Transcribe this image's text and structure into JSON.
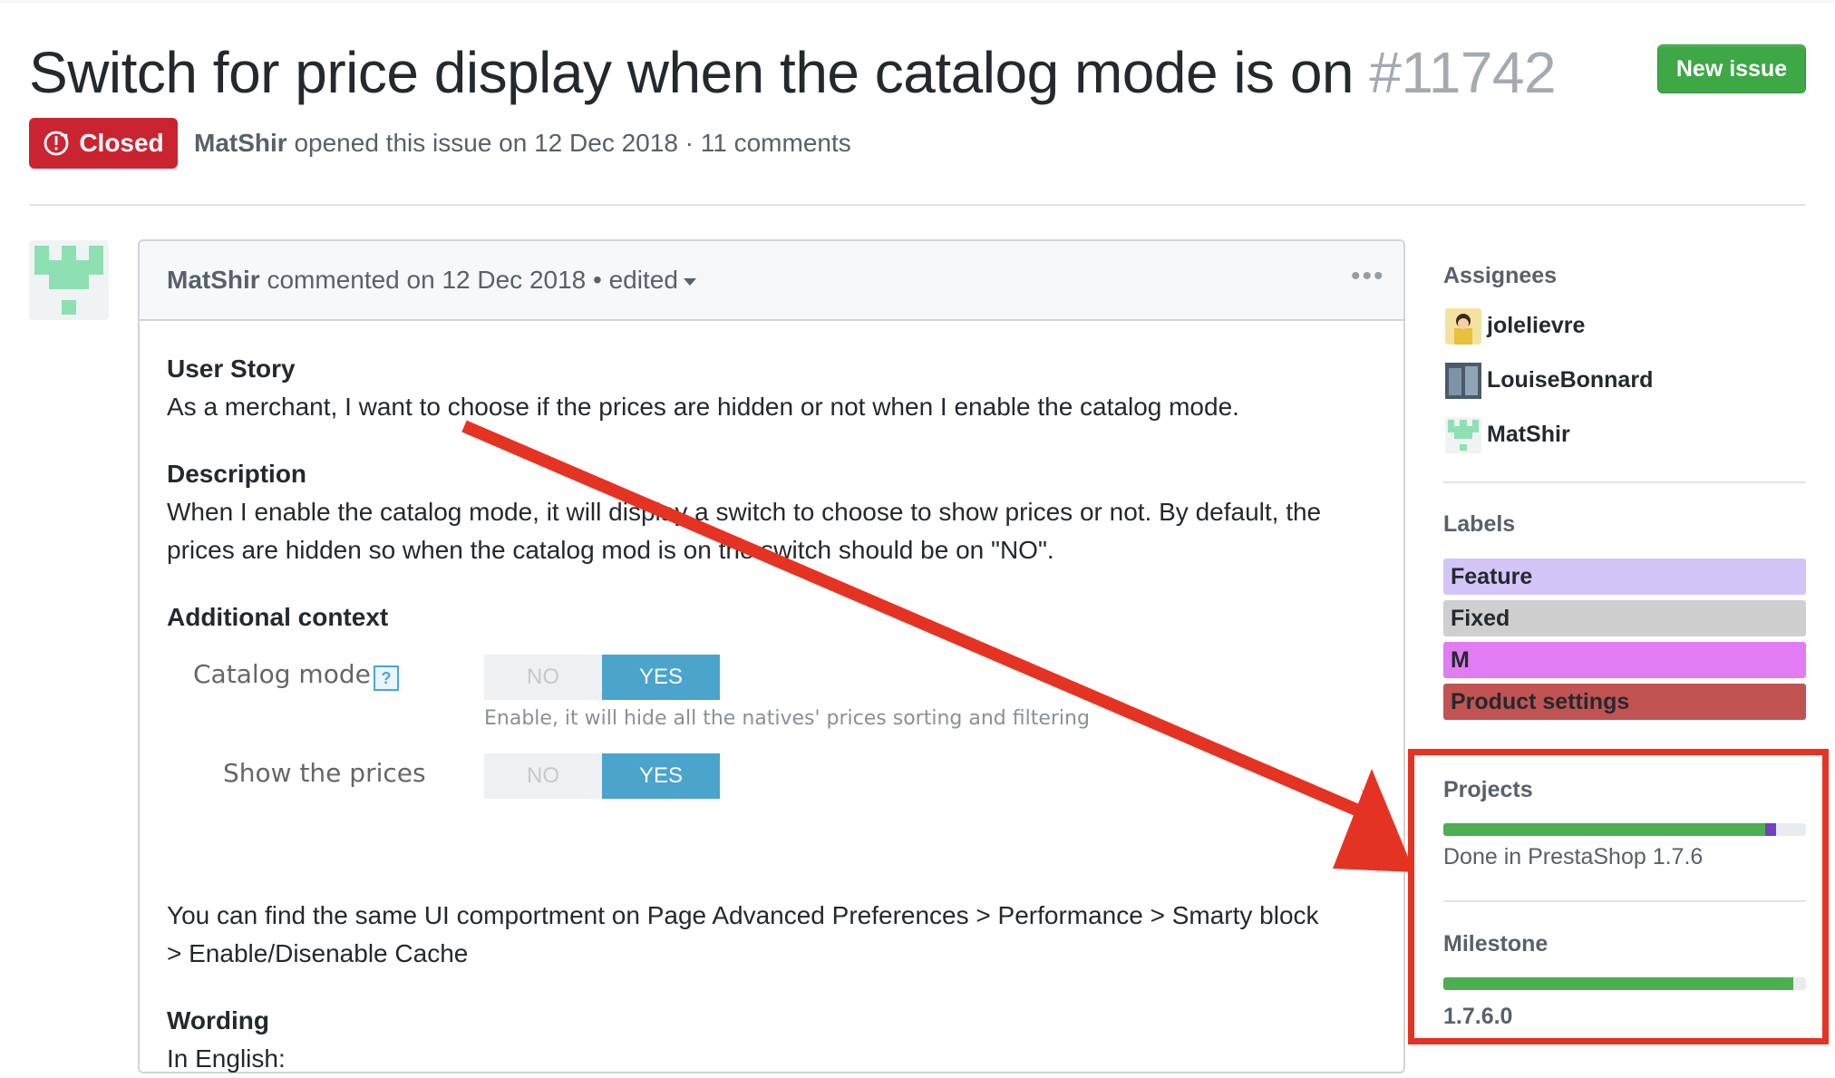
{
  "issue": {
    "title": "Switch for price display when the catalog mode is on",
    "number": "#11742",
    "state": "Closed",
    "author": "MatShir",
    "meta_rest": " opened this issue on 12 Dec 2018 · 11 comments",
    "new_issue_button": "New issue"
  },
  "comment": {
    "author": "MatShir",
    "header_rest": " commented on 12 Dec 2018 • edited",
    "menu_icon": "kebab-horizontal-icon",
    "user_story_heading": "User Story",
    "user_story_text": "As a merchant, I want to choose if the prices are hidden or not when I enable the catalog mode.",
    "description_heading": "Description",
    "description_line1": "When I enable the catalog mode, it will display a switch to choose to show prices or not. By default, the",
    "description_line2": "prices are hidden so when the catalog mod is on the switch should be on \"NO\".",
    "additional_heading": "Additional context",
    "embedded": {
      "catalog_mode_label": "Catalog mode",
      "help_icon_text": "?",
      "no_label": "NO",
      "yes_label": "YES",
      "help_text": "Enable, it will hide all the natives' prices sorting and filtering",
      "show_prices_label": "Show the prices"
    },
    "ui_text_line1": "You can find the same UI comportment on Page Advanced Preferences > Performance > Smarty block",
    "ui_text_line2": "> Enable/Disenable Cache",
    "wording_heading": "Wording",
    "wording_partial": "In English:"
  },
  "sidebar": {
    "assignees_heading": "Assignees",
    "assignees": [
      "jolelievre",
      "LouiseBonnard",
      "MatShir"
    ],
    "labels_heading": "Labels",
    "labels": [
      {
        "name": "Feature",
        "bg": "#d4c5f9",
        "fg": "#24292e"
      },
      {
        "name": "Fixed",
        "bg": "#cfcfcf",
        "fg": "#24292e"
      },
      {
        "name": "M",
        "bg": "#e17cf2",
        "fg": "#24292e"
      },
      {
        "name": "Product settings",
        "bg": "#c25353",
        "fg": "#24292e"
      }
    ],
    "projects_heading": "Projects",
    "project_progress": {
      "done": 0.97,
      "in_progress": 0.03
    },
    "project_name": "Done in PrestaShop 1.7.6",
    "milestone_heading": "Milestone",
    "milestone_progress": 0.97,
    "milestone_name": "1.7.6.0"
  },
  "colors": {
    "closed": "#cb2431",
    "new_issue": "#3fa846",
    "annotation_arrow": "#e53323"
  }
}
